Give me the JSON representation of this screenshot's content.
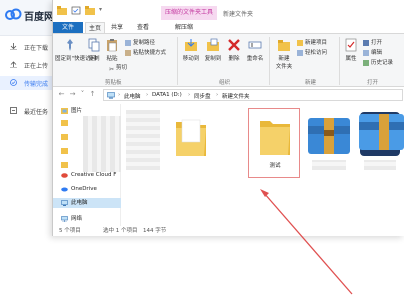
{
  "baidu": {
    "title": "百度网",
    "sidebar": [
      {
        "label": "正在下载",
        "icon": "download-icon"
      },
      {
        "label": "正在上传",
        "icon": "upload-icon"
      },
      {
        "label": "传输完成",
        "icon": "check-circle-icon",
        "active": true
      },
      {
        "label": "最近任务",
        "icon": "task-icon"
      }
    ]
  },
  "explorer": {
    "context_tab": "压缩的文件夹工具",
    "window_title": "新建文件夹",
    "tabs": {
      "file": "文件",
      "home": "主页",
      "share": "共享",
      "view": "查看",
      "manage": "解压缩"
    },
    "ribbon": {
      "pin": "固定到\"快速访问\"",
      "copy": "复制",
      "paste": "粘贴",
      "copy_path": "复制路径",
      "paste_shortcut": "粘贴快捷方式",
      "cut": "剪切",
      "clipboard_group": "剪贴板",
      "move_to": "移动到",
      "copy_to": "复制到",
      "delete": "删除",
      "rename": "重命名",
      "organize_group": "组织",
      "new_folder": "新建\n文件夹",
      "new_item": "新建项目",
      "easy_access": "轻松访问",
      "new_group": "新建",
      "properties": "属性",
      "open": "打开",
      "edit": "编辑",
      "history": "历史记录",
      "open_group": "打开"
    },
    "breadcrumb": [
      "此电脑",
      "DATA1 (D:)",
      "同步盘",
      "新建文件夹"
    ],
    "nav_pane": [
      {
        "label": "图片",
        "icon": "picture-folder-icon"
      },
      {
        "label": "Creative Cloud F",
        "icon": "creative-cloud-icon"
      },
      {
        "label": "OneDrive",
        "icon": "onedrive-icon"
      },
      {
        "label": "此电脑",
        "icon": "computer-icon",
        "selected": true
      },
      {
        "label": "网络",
        "icon": "network-icon"
      }
    ],
    "files": [
      {
        "label": "",
        "icon": "folder-icon"
      },
      {
        "label": "测试",
        "icon": "folder-icon",
        "selected": true
      },
      {
        "label": "",
        "icon": "winrar-archive-icon"
      },
      {
        "label": "",
        "icon": "app-icon"
      },
      {
        "label": "",
        "icon": "winrar-archive-icon"
      }
    ],
    "status": {
      "count": "5 个项目",
      "selected": "选中 1 个项目",
      "size": "144 字节"
    },
    "colors": {
      "file_tab": "#1c6fc0",
      "context_tab": "#c43aa0",
      "selection": "#cce4f7",
      "annotation_arrow": "#e05050"
    }
  }
}
